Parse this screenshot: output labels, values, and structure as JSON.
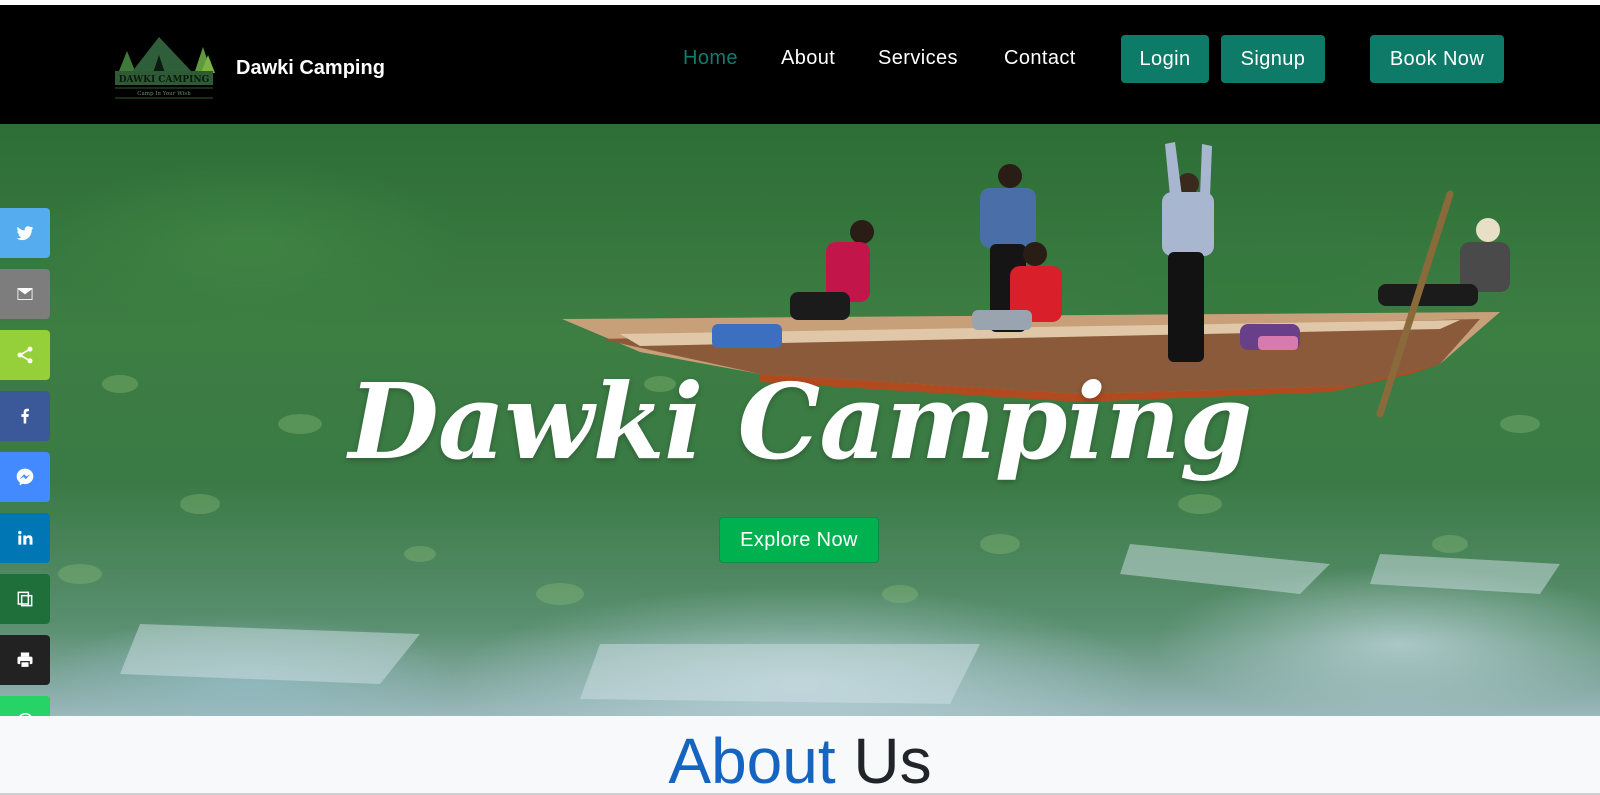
{
  "navbar": {
    "brand_name": "Dawki Camping",
    "logo_text": "DAWKI CAMPING",
    "logo_tagline": "Camp In Your Wish",
    "links": [
      {
        "label": "Home",
        "active": true
      },
      {
        "label": "About",
        "active": false
      },
      {
        "label": "Services",
        "active": false
      },
      {
        "label": "Contact",
        "active": false
      }
    ],
    "login_label": "Login",
    "signup_label": "Signup",
    "book_label": "Book Now"
  },
  "hero": {
    "title": "Dawki Camping",
    "cta_label": "Explore Now"
  },
  "share_bar": {
    "items": [
      {
        "icon": "twitter-icon",
        "color": "#55acee"
      },
      {
        "icon": "email-icon",
        "color": "#7d7d7d"
      },
      {
        "icon": "share-icon",
        "color": "#95d03a"
      },
      {
        "icon": "facebook-icon",
        "color": "#3b5998"
      },
      {
        "icon": "messenger-icon",
        "color": "#448aff"
      },
      {
        "icon": "linkedin-icon",
        "color": "#0077b5"
      },
      {
        "icon": "copy-link-icon",
        "color": "#1e6f3a"
      },
      {
        "icon": "print-icon",
        "color": "#222222"
      },
      {
        "icon": "whatsapp-icon",
        "color": "#25d366"
      }
    ]
  },
  "about": {
    "heading_accent": "About",
    "heading_rest": "Us"
  },
  "colors": {
    "nav_bg": "#000000",
    "accent_teal": "#0e7a68",
    "active_link": "#127b6e",
    "cta_green": "#00b14f",
    "about_blue": "#1565c0"
  }
}
